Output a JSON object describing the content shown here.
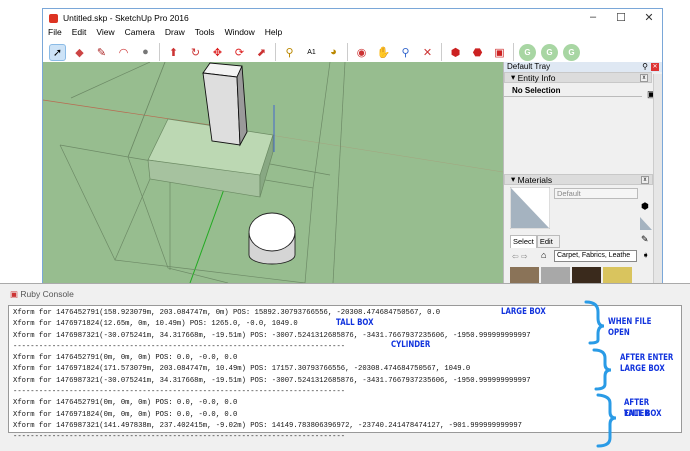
{
  "window": {
    "title": "Untitled.skp - SketchUp Pro 2016",
    "minimize": "–",
    "maximize": "☐",
    "close": "✕"
  },
  "menu": [
    "File",
    "Edit",
    "View",
    "Camera",
    "Draw",
    "Tools",
    "Window",
    "Help"
  ],
  "toolbar": {
    "icons": [
      "select-icon",
      "eraser-icon",
      "pencil-icon",
      "arc-icon",
      "circle-icon",
      "push-pull-icon",
      "follow-me-icon",
      "move-icon",
      "rotate-icon",
      "scale-icon",
      "tape-measure-icon",
      "text-icon",
      "paint-bucket-icon",
      "orbit-icon",
      "pan-icon",
      "zoom-icon",
      "zoom-extents-icon",
      "warehouse-icon",
      "extension-icon",
      "share-icon"
    ],
    "g_label": "G"
  },
  "tray": {
    "title": "Default Tray",
    "entity_info": {
      "header": "Entity Info",
      "selection": "No Selection"
    },
    "materials": {
      "header": "Materials",
      "name_placeholder": "Default",
      "tabs": [
        "Select",
        "Edit"
      ],
      "library": "Carpet, Fabrics, Leathe"
    }
  },
  "console": {
    "title": "Ruby Console",
    "lines": [
      "Xform for 1476452791(158.923079m, 203.084747m, 0m) POS: 15892.30793766556, -20308.474684750567, 0.0",
      "Xform for 1476971824(12.65m, 0m, 10.49m) POS: 1265.0, -0.0, 1049.0",
      "Xform for 1476987321(-30.075241m, 34.317668m, -19.51m) POS: -3007.5241312685876, -3431.7667937235606, -1950.999999999997",
      "-----------------------------------------------------------------------------",
      "Xform for 1476452791(0m, 0m, 0m) POS: 0.0, -0.0, 0.0",
      "Xform for 1476971824(171.573079m, 203.084747m, 10.49m) POS: 17157.30793766556, -20308.474684750567, 1049.0",
      "Xform for 1476987321(-30.075241m, 34.317668m, -19.51m) POS: -3007.5241312685876, -3431.7667937235606, -1950.999999999997",
      "-----------------------------------------------------------------------------",
      "Xform for 1476452791(0m, 0m, 0m) POS: 0.0, -0.0, 0.0",
      "Xform for 1476971824(0m, 0m, 0m) POS: 0.0, -0.0, 0.0",
      "Xform for 1476987321(141.497838m, 237.402415m, -9.02m) POS: 14149.783806396972, -23740.241478474127, -901.999999999997",
      "-----------------------------------------------------------------------------"
    ]
  },
  "annotations": {
    "large_box": "LARGE BOX",
    "tall_box": "TALL BOX",
    "cylinder": "CYLINDER",
    "when_open": "WHEN FILE OPEN",
    "after_large_1": "AFTER ENTER",
    "after_large_2": "LARGE BOX",
    "after_tall_1": "AFTER ENTER",
    "after_tall_2": "TALL BOX"
  },
  "colors": {
    "viewport": "#97bd8f",
    "annotation": "#1133dd",
    "brace": "#2a9be6"
  }
}
